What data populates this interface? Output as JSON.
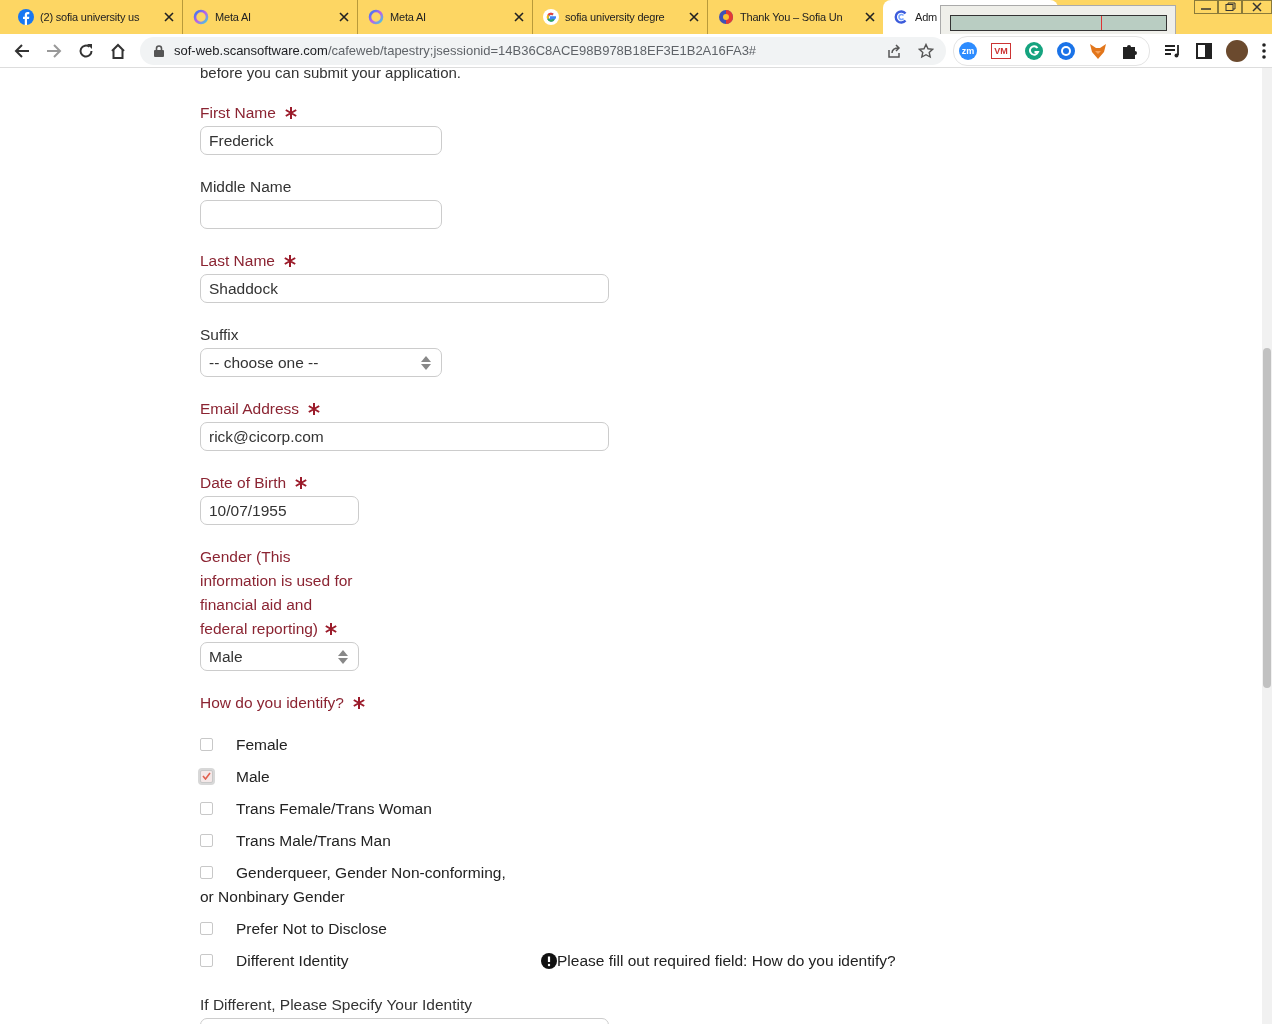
{
  "browser": {
    "tabs": [
      {
        "title": "(2) sofia university us",
        "kind": "facebook",
        "selected": false
      },
      {
        "title": "Meta AI",
        "kind": "ring",
        "selected": false
      },
      {
        "title": "Meta AI",
        "kind": "ring",
        "selected": false
      },
      {
        "title": "sofia university degre",
        "kind": "google",
        "selected": false
      },
      {
        "title": "Thank You – Sofia Un",
        "kind": "globe",
        "selected": false
      },
      {
        "title": "Adm",
        "kind": "c",
        "selected": true
      }
    ],
    "url_host": "sof-web.scansoftware.com",
    "url_path": "/cafeweb/tapestry;jsessionid=14B36C8ACE98B978B18EF3E1B2A16FA3#",
    "extensions": [
      {
        "kind": "zoom",
        "label": "zm"
      },
      {
        "kind": "vm",
        "label": "VM"
      },
      {
        "kind": "grammar"
      },
      {
        "kind": "target"
      },
      {
        "kind": "fox"
      },
      {
        "kind": "puzzle"
      }
    ]
  },
  "form": {
    "intro": "before you can submit your application.",
    "fields": [
      {
        "label": "First Name",
        "required": true,
        "kind": "text",
        "value": "Frederick"
      },
      {
        "label": "Middle Name",
        "required": false,
        "kind": "text"
      },
      {
        "label": "Last Name",
        "required": true,
        "kind": "text",
        "value": "Shaddock"
      },
      {
        "label": "Suffix",
        "required": false,
        "kind": "select",
        "value": "-- choose one --"
      },
      {
        "label": "Email Address",
        "required": true,
        "kind": "text",
        "value": "rick@cicorp.com"
      },
      {
        "label": "Date of Birth",
        "required": true,
        "kind": "text",
        "value": "10/07/1955"
      },
      {
        "label": "Gender (This information is used for financial aid and federal reporting)",
        "required": true,
        "kind": "select",
        "value": "Male"
      }
    ],
    "identity": {
      "label": "How do you identify?",
      "required": true,
      "options": [
        {
          "label": "Female",
          "checked": false
        },
        {
          "label": "Male",
          "checked": true
        },
        {
          "label": "Trans Female/Trans Woman",
          "checked": false
        },
        {
          "label": "Trans Male/Trans Man",
          "checked": false
        },
        {
          "label": "Genderqueer, Gender Non-conforming, or Nonbinary Gender",
          "checked": false
        },
        {
          "label": "Prefer Not to Disclose",
          "checked": false
        },
        {
          "label": "Different Identity",
          "checked": false
        }
      ],
      "error": "Please fill out required field: How do you identify?"
    },
    "specify": {
      "label": "If Different, Please Specify Your Identity",
      "required": false
    }
  }
}
